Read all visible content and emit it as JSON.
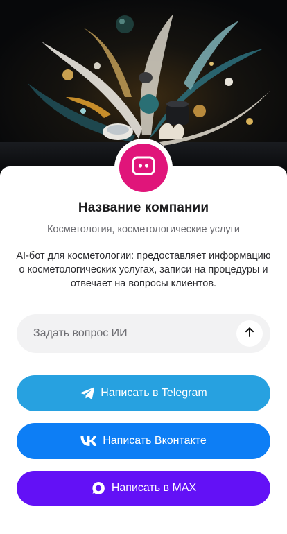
{
  "profile": {
    "name": "Название компании",
    "category": "Косметология, косметологические услуги",
    "description": "AI-бот для косметологии: предоставляет информацию о косметологических услугах, записи на процедуры и отвечает на вопросы клиентов."
  },
  "ask": {
    "placeholder": "Задать вопрос ИИ",
    "send_icon": "arrow-up-icon"
  },
  "buttons": [
    {
      "label": "Написать в Telegram",
      "icon": "telegram-icon",
      "color": "#27a1e0"
    },
    {
      "label": "Написать Вконтакте",
      "icon": "vk-icon",
      "color": "#0d7ef5"
    },
    {
      "label": "Написать в MAX",
      "icon": "max-icon",
      "color": "#6311f6"
    }
  ],
  "colors": {
    "avatar": "#e0157a",
    "input_bg": "#f2f2f3"
  },
  "icons": {
    "avatar": "chat-bot-icon"
  }
}
